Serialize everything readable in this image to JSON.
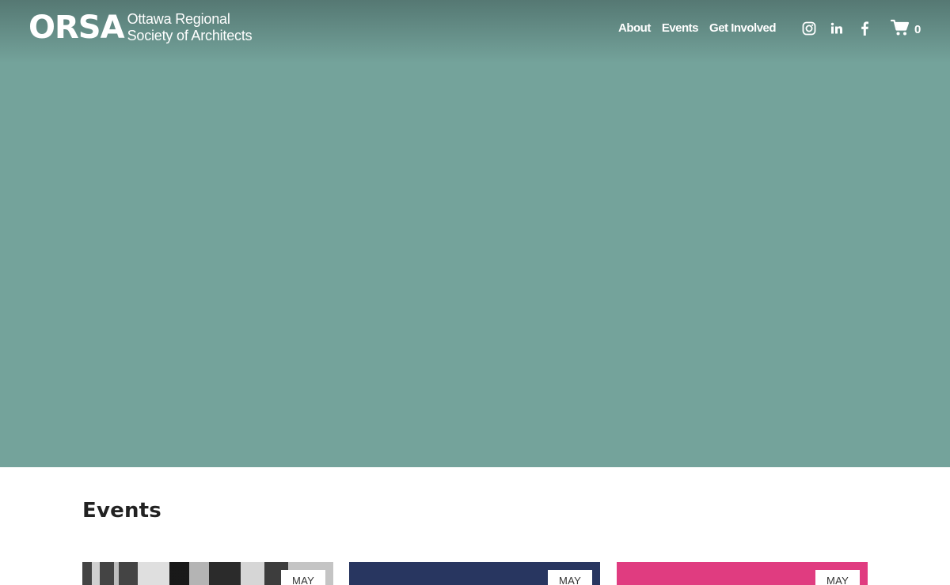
{
  "brand": {
    "mark": "ORSA",
    "line1": "Ottawa Regional",
    "line2": "Society of Architects"
  },
  "nav": {
    "items": [
      {
        "label": "About"
      },
      {
        "label": "Events"
      },
      {
        "label": "Get Involved"
      }
    ]
  },
  "social": {
    "icons": [
      "instagram-icon",
      "linkedin-icon",
      "facebook-icon"
    ]
  },
  "cart": {
    "count": "0"
  },
  "colors": {
    "hero_bg": "#74a39b",
    "card_navy": "#283660",
    "card_pink": "#e03c80"
  },
  "events": {
    "heading": "Events",
    "cards": [
      {
        "month": "MAY"
      },
      {
        "month": "MAY"
      },
      {
        "month": "MAY"
      }
    ]
  }
}
